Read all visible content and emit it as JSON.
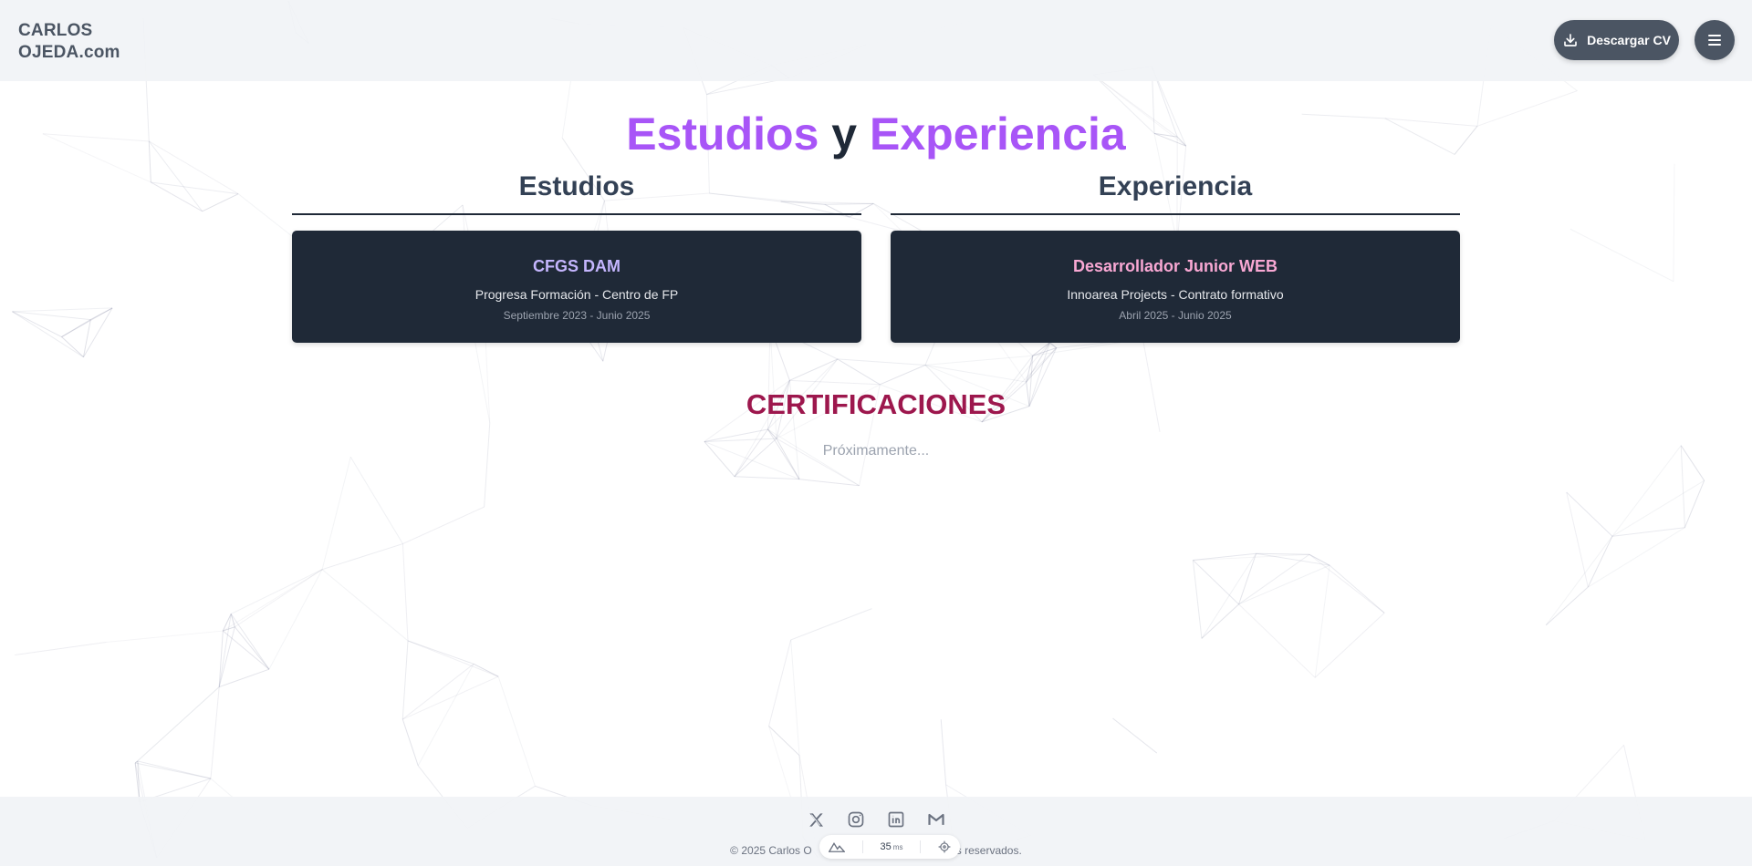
{
  "header": {
    "logo_line1": "CARLOS",
    "logo_line2": "OJEDA.com",
    "download_cv_label": "Descargar CV",
    "download_icon": "download-icon",
    "menu_icon": "hamburger-menu-icon"
  },
  "main": {
    "title_part1": "Estudios",
    "title_part2": "y",
    "title_part3": "Experiencia",
    "studies": {
      "heading": "Estudios",
      "card": {
        "title": "CFGS DAM",
        "organization": "Progresa Formación - Centro de FP",
        "dates": "Septiembre 2023 - Junio 2025"
      }
    },
    "experience": {
      "heading": "Experiencia",
      "card": {
        "title": "Desarrollador Junior WEB",
        "organization": "Innoarea Projects - Contrato formativo",
        "dates": "Abril 2025 - Junio 2025"
      }
    },
    "certifications": {
      "heading": "CERTIFICACIONES",
      "placeholder": "Próximamente..."
    }
  },
  "footer": {
    "social_icons": [
      "x-twitter-icon",
      "instagram-icon",
      "linkedin-icon",
      "gmail-icon"
    ],
    "copyright_left": "© 2025 Carlos O",
    "copyright_right": "nos reservados.",
    "devtools": {
      "render_time": "35",
      "render_unit": "ms"
    }
  },
  "colors": {
    "accent_purple": "#a855f7",
    "card_bg": "#1f2937",
    "studies_card_title": "#c4b5fd",
    "experience_card_title": "#f9a8d4",
    "certifications": "#9d174d",
    "button_bg": "#4b5563"
  }
}
